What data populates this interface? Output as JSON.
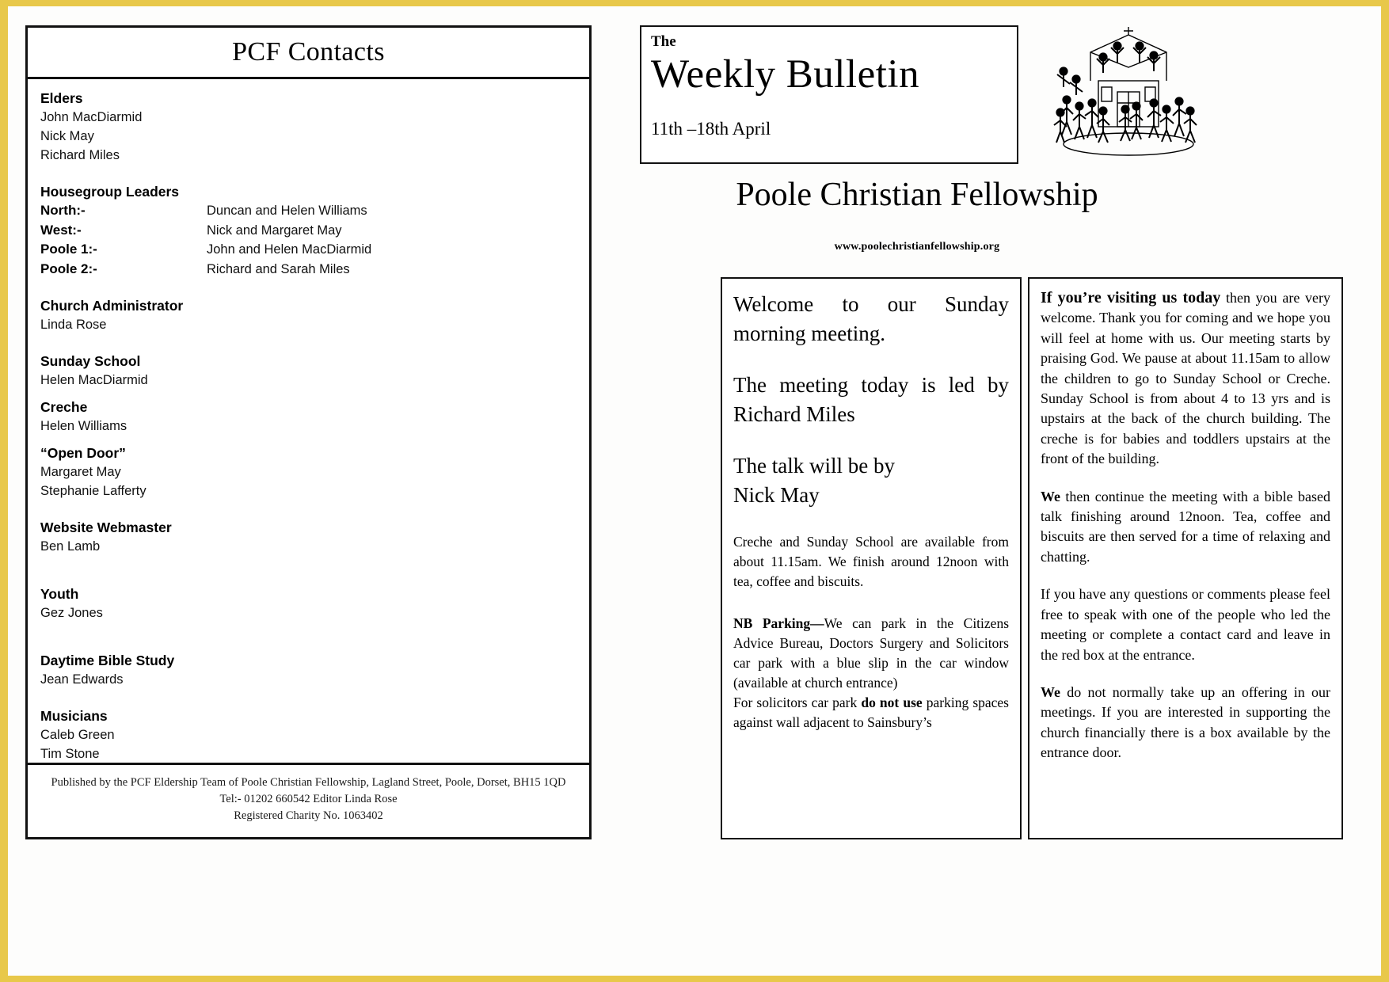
{
  "contacts": {
    "title": "PCF Contacts",
    "sections": [
      {
        "heading": "Elders",
        "names": [
          "John MacDiarmid",
          "Nick May",
          "Richard Miles"
        ]
      },
      {
        "heading": "Church Administrator",
        "names": [
          "Linda Rose"
        ]
      },
      {
        "heading": "Sunday School",
        "names": [
          "Helen MacDiarmid"
        ]
      },
      {
        "heading": "Creche",
        "names": [
          "Helen Williams"
        ]
      },
      {
        "heading": "“Open Door”",
        "names": [
          "Margaret May",
          "Stephanie Lafferty"
        ]
      },
      {
        "heading": "Website Webmaster",
        "names": [
          "Ben Lamb"
        ]
      },
      {
        "heading": "Youth",
        "names": [
          "Gez Jones"
        ]
      },
      {
        "heading": "Daytime Bible Study",
        "names": [
          "Jean Edwards"
        ]
      },
      {
        "heading": "Musicians",
        "names": [
          "Caleb Green",
          "Tim Stone"
        ]
      }
    ],
    "housegroups": {
      "heading": "Housegroup Leaders",
      "rows": [
        {
          "label": "North:-",
          "people": "Duncan and Helen Williams"
        },
        {
          "label": "West:-",
          "people": "Nick and Margaret May"
        },
        {
          "label": "Poole 1:-",
          "people": "John and Helen MacDiarmid"
        },
        {
          "label": "Poole 2:-",
          "people": "Richard and Sarah Miles"
        }
      ]
    },
    "footer": {
      "line1": "Published by  the PCF Eldership Team of Poole Christian Fellowship, Lagland Street, Poole, Dorset, BH15 1QD",
      "line2": "Tel:- 01202 660542  Editor Linda Rose",
      "line3": "Registered Charity No. 1063402"
    }
  },
  "masthead": {
    "the": "The",
    "title": "Weekly Bulletin",
    "dates": "11th –18th April",
    "church_name": "Poole Christian Fellowship",
    "url": "www.poolechristianfellowship.org"
  },
  "welcome": {
    "line1": "Welcome to our Sunday morning meeting.",
    "line2": "The meeting today is led by Richard Miles",
    "line3": "The talk will be  by",
    "line4": "Nick May",
    "creche_note": "Creche and Sunday School are available from about 11.15am.  We finish around 12noon with tea, coffee and biscuits.",
    "parking_label": "NB Parking—",
    "parking_body": "We can park in the Citizens Advice Bureau, Doctors Surgery and Solicitors car park with a blue slip in the car window (available at church entrance)",
    "parking_line2_pre": "For solicitors car park ",
    "parking_line2_bold": "do  not use",
    "parking_line2_post": " parking spaces against wall adjacent to Sainsbury’s"
  },
  "visiting": {
    "lead": "If you’re visiting us today",
    "para1": " then you are very welcome.  Thank you for coming and we hope you will feel at home with us.  Our meeting starts by praising God. We pause at about 11.15am to allow the children to go to Sunday School or Creche. Sunday School is from about 4 to 13 yrs and is upstairs at the back of the church building.  The creche is for babies and toddlers upstairs at the front of the building.",
    "para2_bold": "We",
    "para2": " then continue the meeting with a bible based talk finishing around 12noon. Tea, coffee and biscuits  are then served for a time of relaxing and chatting.",
    "para3": "If you have any questions or comments please feel free to speak with one of  the people who led the meeting or complete a contact card and leave in the red box at the entrance.",
    "para4_bold": "We",
    "para4": " do not normally take up an offering in our meetings.  If you are interested in supporting the church financially there is a box available by the entrance door."
  }
}
